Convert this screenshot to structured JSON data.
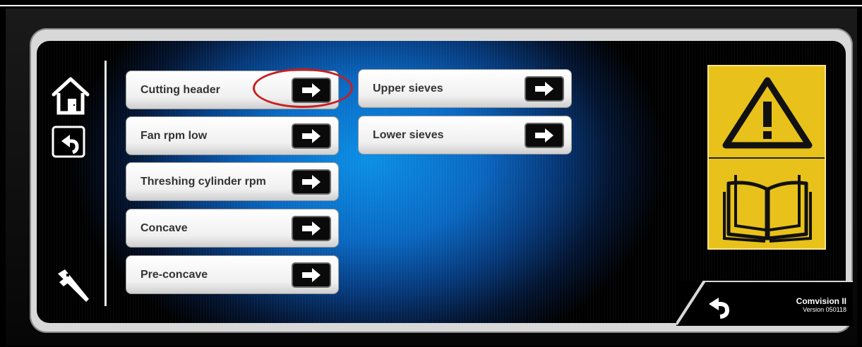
{
  "menu_left": [
    {
      "label": "Cutting header"
    },
    {
      "label": "Fan rpm low"
    },
    {
      "label": "Threshing cylinder rpm"
    },
    {
      "label": "Concave"
    },
    {
      "label": "Pre-concave"
    }
  ],
  "menu_right": [
    {
      "label": "Upper sieves"
    },
    {
      "label": "Lower sieves"
    }
  ],
  "highlight": {
    "target": "Cutting header",
    "color": "#c81e1e"
  },
  "brand": {
    "name": "Comvision II",
    "version": "Version 050118"
  },
  "icons": {
    "home": "home-icon",
    "back": "back-icon",
    "tools": "caliper-icon",
    "warning": "warning-icon",
    "manual": "manual-book-icon",
    "bottom_back": "back-icon"
  },
  "colors": {
    "accent": "#0a8fe6",
    "warning": "#e8c21a"
  }
}
